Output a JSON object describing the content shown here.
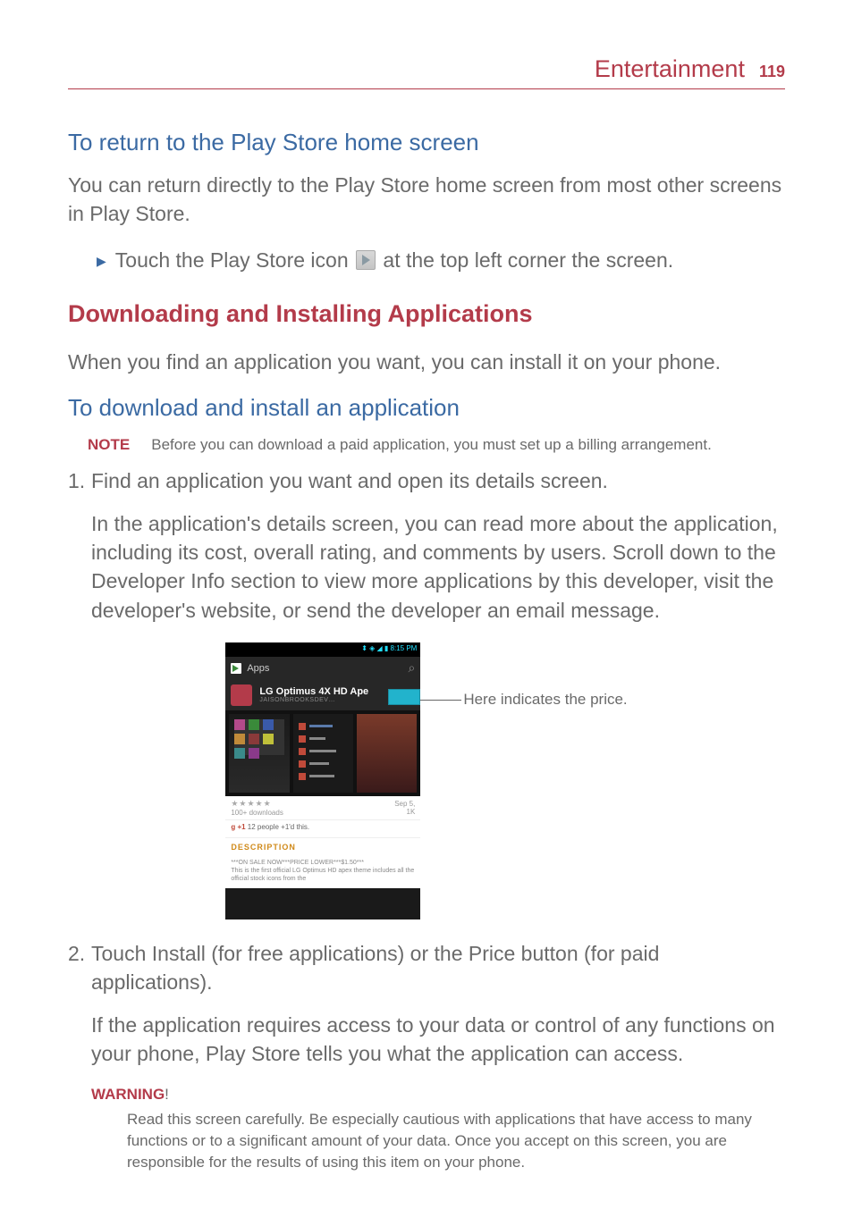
{
  "header": {
    "section": "Entertainment",
    "page": "119"
  },
  "s1": {
    "title": "To return to the Play Store home screen",
    "intro": "You can return directly to the Play Store home screen from most other screens in Play Store.",
    "bullet_pre": "Touch the ",
    "bullet_bold": "Play Store",
    "bullet_mid": " icon ",
    "bullet_post": " at the top left corner the screen."
  },
  "s2": {
    "title": "Downloading and Installing Applications",
    "intro": "When you find an application you want, you can install it on your phone."
  },
  "s3": {
    "title": "To download and install an application",
    "note_label": "NOTE",
    "note_text": "Before you can download a paid application, you must set up a billing arrangement.",
    "step1_num": "1.",
    "step1": "Find an application you want and open its details screen.",
    "step1_follow": "In the application's details screen, you can read more about the application, including its cost, overall rating, and comments by users. Scroll down to the Developer Info section to view more applications by this developer, visit the developer's website, or send the developer an email message.",
    "callout": "Here indicates the price.",
    "step2_num": "2.",
    "step2_pre": "Touch ",
    "step2_b1": "Install",
    "step2_mid": " (for free applications) or the ",
    "step2_b2": "Price",
    "step2_post": " button (for paid applications).",
    "step2_follow": "If the application requires access to your data or control of any functions on your phone, Play Store tells you what the application can access.",
    "warn_label": "WARNING",
    "warn_excl": "!",
    "warn_text": "Read this screen carefully. Be especially cautious with applications that have access to many functions or to a significant amount of your data. Once you accept on this screen, you are responsible for the results of using this item on your phone."
  },
  "shot": {
    "status": "⬍ ◈ ◢ ▮ 8:15 PM",
    "bar_label": "Apps",
    "app_title": "LG Optimus 4X HD Ape",
    "app_sub": "JAISONBROOKSDEV…",
    "stars": "★★★★★",
    "downloads": "100+ downloads",
    "date": "Sep 5,",
    "size": "1K",
    "plusone_pre": "g +1",
    "plusone": " 12 people +1'd this.",
    "desc_label": "DESCRIPTION",
    "desc1": "***ON SALE NOW***PRICE LOWER***$1.50***",
    "desc2": "This is the first official LG Optimus HD apex theme includes all the official stock icons from the"
  }
}
